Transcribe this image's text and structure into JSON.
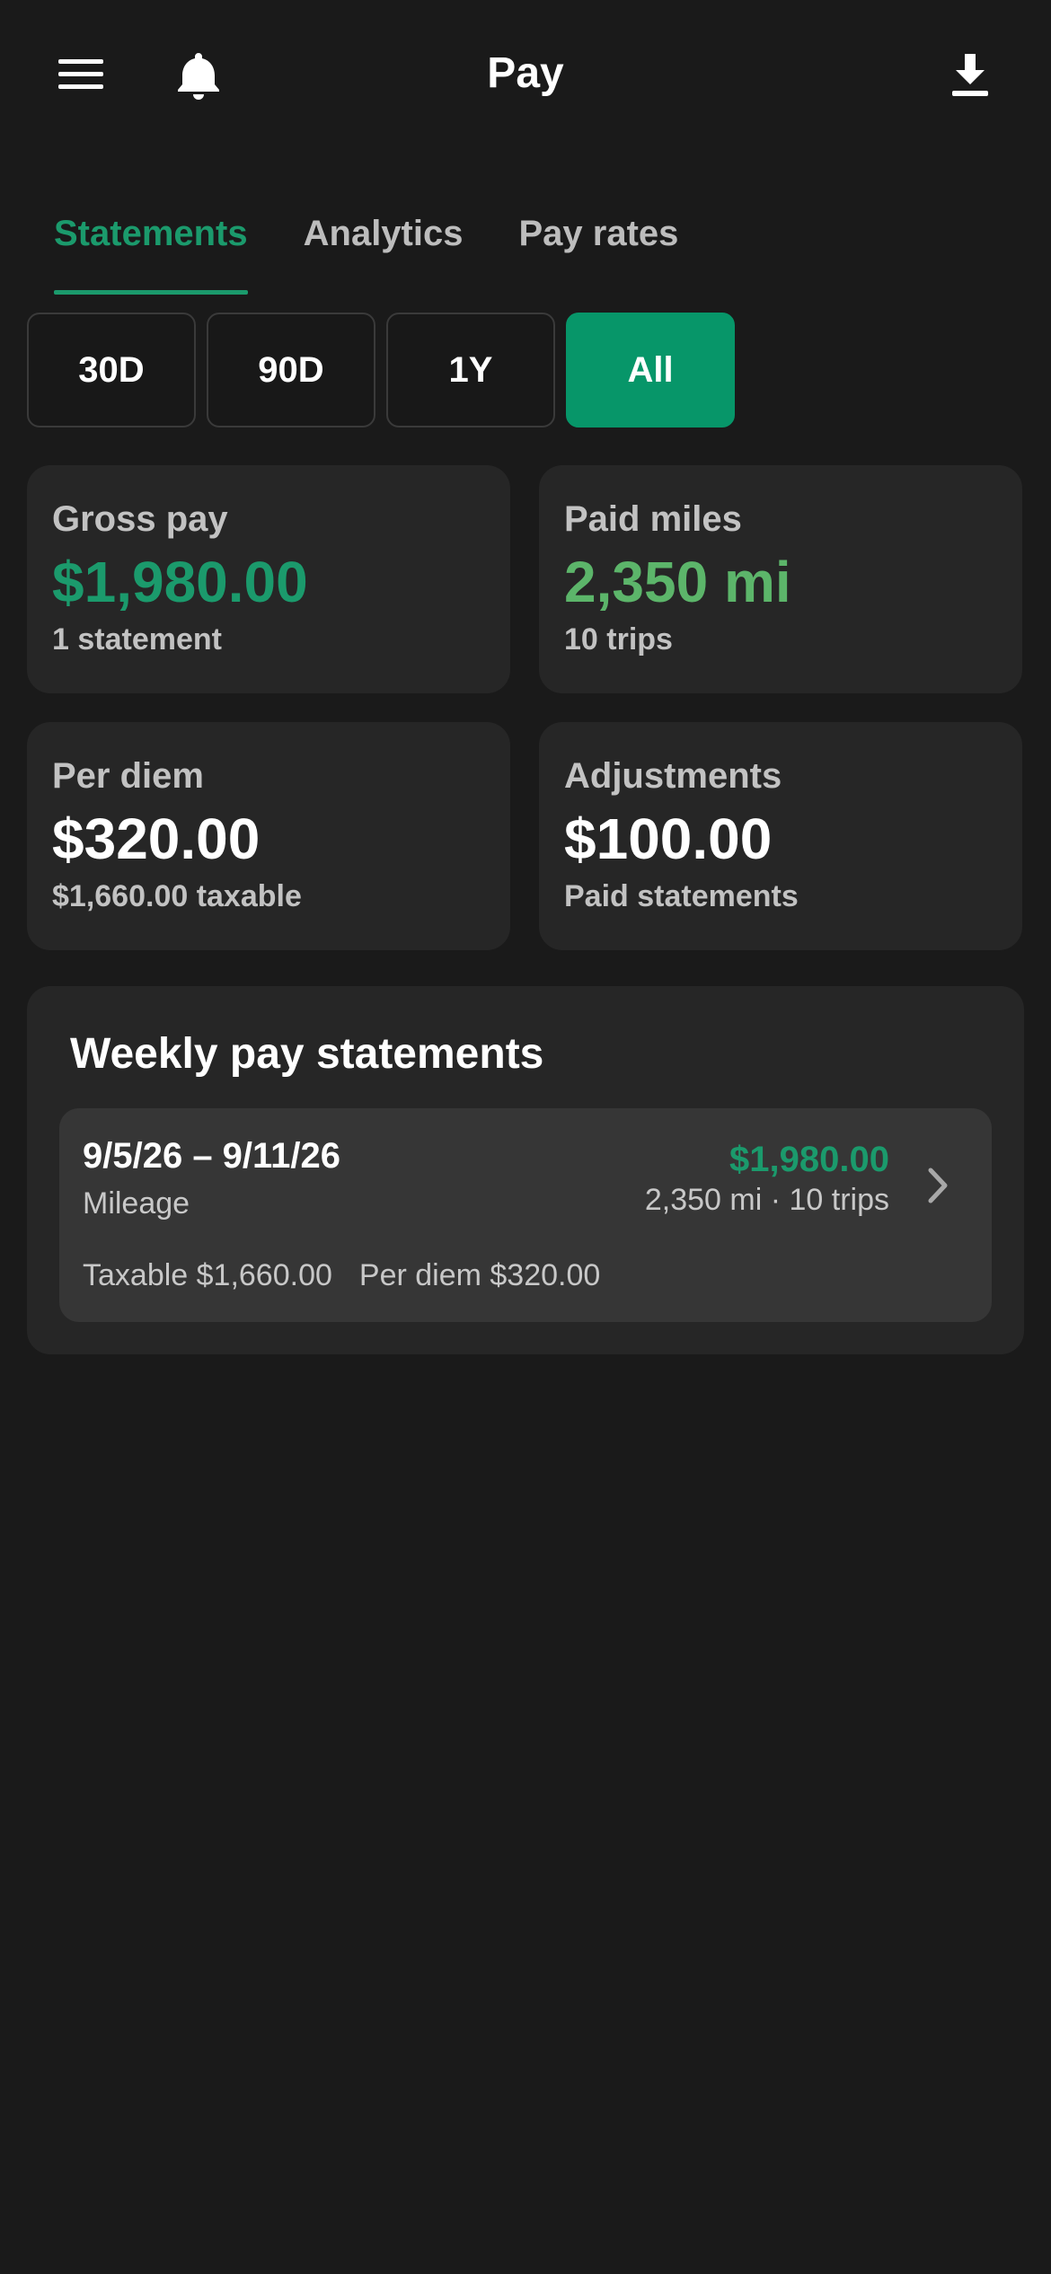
{
  "header": {
    "title": "Pay",
    "icons": {
      "menu": "menu-icon",
      "notifications": "bell-icon",
      "download": "download-icon"
    }
  },
  "tabs": [
    {
      "label": "Statements",
      "active": true
    },
    {
      "label": "Analytics",
      "active": false
    },
    {
      "label": "Pay rates",
      "active": false
    }
  ],
  "ranges": [
    {
      "label": "30D",
      "selected": false
    },
    {
      "label": "90D",
      "selected": false
    },
    {
      "label": "1Y",
      "selected": false
    },
    {
      "label": "All",
      "selected": true
    }
  ],
  "stats": {
    "gross_pay": {
      "label": "Gross pay",
      "value": "$1,980.00",
      "sub": "1 statement"
    },
    "paid_miles": {
      "label": "Paid miles",
      "value": "2,350 mi",
      "sub": "10 trips"
    },
    "per_diem": {
      "label": "Per diem",
      "value": "$320.00",
      "sub": "$1,660.00 taxable"
    },
    "adjustments": {
      "label": "Adjustments",
      "value": "$100.00",
      "sub": "Paid statements"
    }
  },
  "weekly": {
    "title": "Weekly pay statements",
    "statements": [
      {
        "range": "9/5/26 – 9/11/26",
        "type": "Mileage",
        "amount": "$1,980.00",
        "miles_trips": "2,350 mi · 10 trips",
        "taxable": "Taxable $1,660.00",
        "per_diem": "Per diem $320.00"
      }
    ]
  },
  "colors": {
    "background": "#1a1a1a",
    "card": "#262626",
    "accent": "#079669",
    "accent_text": "#1b9a6c",
    "miles_green": "#5cb56a"
  }
}
